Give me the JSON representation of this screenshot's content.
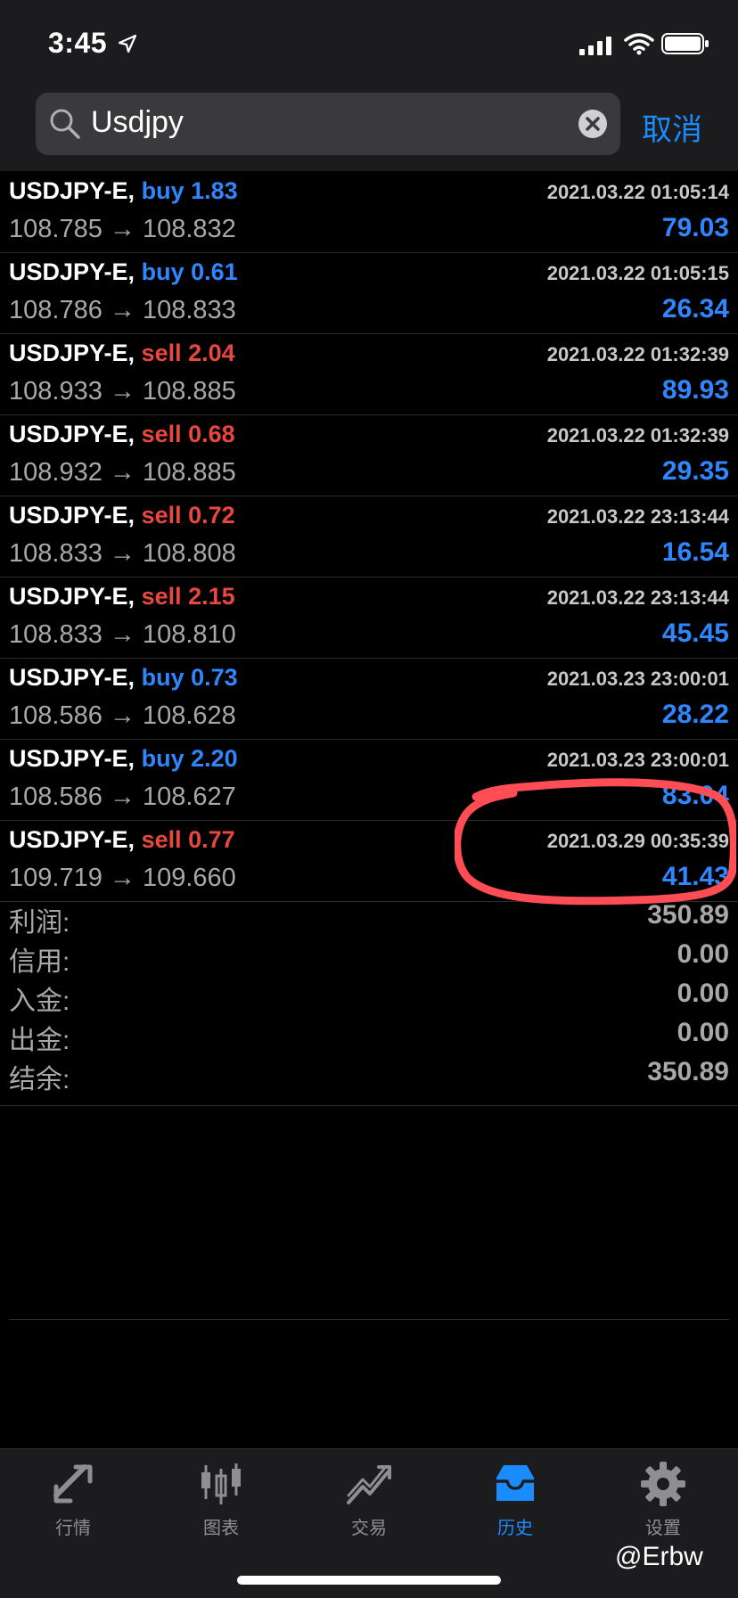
{
  "status_bar": {
    "time": "3:45"
  },
  "search": {
    "query": "Usdjpy",
    "cancel_label": "取消"
  },
  "trades": [
    {
      "symbol": "USDJPY-E,",
      "side": "buy",
      "volume": "1.83",
      "prices": "108.785 → 108.832",
      "time": "2021.03.22 01:05:14",
      "profit": "79.03"
    },
    {
      "symbol": "USDJPY-E,",
      "side": "buy",
      "volume": "0.61",
      "prices": "108.786 → 108.833",
      "time": "2021.03.22 01:05:15",
      "profit": "26.34"
    },
    {
      "symbol": "USDJPY-E,",
      "side": "sell",
      "volume": "2.04",
      "prices": "108.933 → 108.885",
      "time": "2021.03.22 01:32:39",
      "profit": "89.93"
    },
    {
      "symbol": "USDJPY-E,",
      "side": "sell",
      "volume": "0.68",
      "prices": "108.932 → 108.885",
      "time": "2021.03.22 01:32:39",
      "profit": "29.35"
    },
    {
      "symbol": "USDJPY-E,",
      "side": "sell",
      "volume": "0.72",
      "prices": "108.833 → 108.808",
      "time": "2021.03.22 23:13:44",
      "profit": "16.54"
    },
    {
      "symbol": "USDJPY-E,",
      "side": "sell",
      "volume": "2.15",
      "prices": "108.833 → 108.810",
      "time": "2021.03.22 23:13:44",
      "profit": "45.45"
    },
    {
      "symbol": "USDJPY-E,",
      "side": "buy",
      "volume": "0.73",
      "prices": "108.586 → 108.628",
      "time": "2021.03.23 23:00:01",
      "profit": "28.22"
    },
    {
      "symbol": "USDJPY-E,",
      "side": "buy",
      "volume": "2.20",
      "prices": "108.586 → 108.627",
      "time": "2021.03.23 23:00:01",
      "profit": "83.04"
    },
    {
      "symbol": "USDJPY-E,",
      "side": "sell",
      "volume": "0.77",
      "prices": "109.719 → 109.660",
      "time": "2021.03.29 00:35:39",
      "profit": "41.43"
    }
  ],
  "summary": [
    {
      "label": "利润:",
      "value": "350.89"
    },
    {
      "label": "信用:",
      "value": "0.00"
    },
    {
      "label": "入金:",
      "value": "0.00"
    },
    {
      "label": "出金:",
      "value": "0.00"
    },
    {
      "label": "结余:",
      "value": "350.89"
    }
  ],
  "tabs": [
    {
      "label": "行情",
      "icon": "quotes-icon",
      "active": false
    },
    {
      "label": "图表",
      "icon": "chart-icon",
      "active": false
    },
    {
      "label": "交易",
      "icon": "trade-icon",
      "active": false
    },
    {
      "label": "历史",
      "icon": "history-icon",
      "active": true
    },
    {
      "label": "设置",
      "icon": "settings-icon",
      "active": false
    }
  ],
  "watermark": "@Erbw",
  "colors": {
    "buy": "#2f86ff",
    "sell": "#e8463f",
    "accent": "#1a8cff",
    "annotation": "#ff4d55"
  }
}
